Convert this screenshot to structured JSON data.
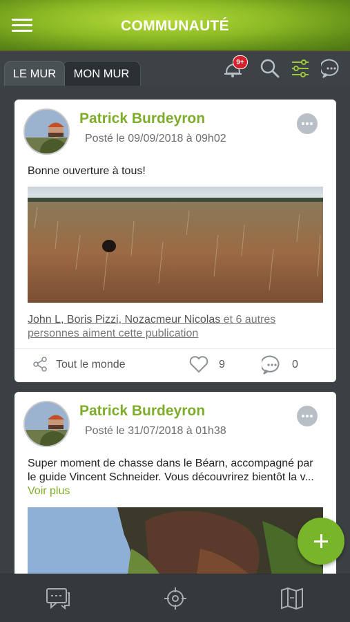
{
  "header": {
    "title": "COMMUNAUTÉ",
    "menu_icon": "hamburger-menu-icon"
  },
  "tabs": [
    {
      "label": "LE MUR",
      "active": true
    },
    {
      "label": "MON MUR",
      "active": false
    }
  ],
  "toolbar": {
    "notifications_badge": "9+",
    "icons": [
      "notification-bell-icon",
      "search-icon",
      "filter-sliders-icon",
      "chat-bubble-icon"
    ]
  },
  "posts": [
    {
      "author": "Patrick Burdeyron",
      "date": "Posté le 09/09/2018 à 09h02",
      "text": "Bonne ouverture à tous!",
      "likers": "John L, Boris Pizzi, Nozacmeur Nicolas",
      "likers_suffix": " et 6 autres personnes aiment cette publication",
      "visibility": "Tout le monde",
      "likes_count": "9",
      "comments_count": "0"
    },
    {
      "author": "Patrick Burdeyron",
      "date": "Posté le 31/07/2018 à 01h38",
      "text": "Super moment de chasse dans le Béarn, accompagné par le guide Vincent Schneider. Vous découvrirez bientôt la v...",
      "see_more": "Voir plus"
    }
  ],
  "colors": {
    "accent": "#7dad2a",
    "header_green": "#8ab824",
    "badge_red": "#d8202a",
    "background": "#3a4044"
  },
  "bottom_nav": {
    "icons": [
      "messages-icon",
      "target-crosshair-icon",
      "map-icon"
    ]
  }
}
